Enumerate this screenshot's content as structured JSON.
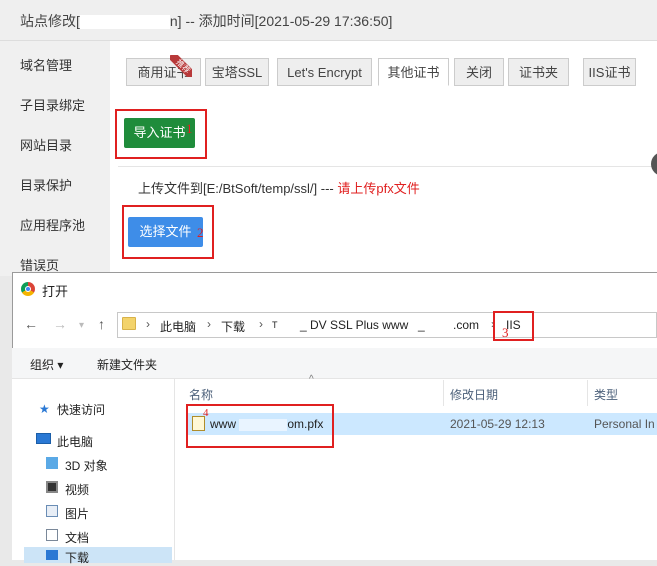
{
  "window": {
    "title_prefix": "站点修改[",
    "title_suffix": "n] -- 添加时间[2021-05-29 17:36:50]"
  },
  "sidebar": {
    "items": [
      {
        "label": "域名管理"
      },
      {
        "label": "子目录绑定"
      },
      {
        "label": "网站目录"
      },
      {
        "label": "目录保护"
      },
      {
        "label": "应用程序池"
      },
      {
        "label": "错误页"
      }
    ]
  },
  "tabs": [
    {
      "label": "商用证书"
    },
    {
      "label": "宝塔SSL"
    },
    {
      "label": "Let's Encrypt"
    },
    {
      "label": "其他证书",
      "active": true
    },
    {
      "label": "关闭"
    },
    {
      "label": "证书夹"
    },
    {
      "label": "IIS证书"
    }
  ],
  "ribbon": "推荐",
  "import_button": "导入证书",
  "upload": {
    "title": "上传文件到[E:/BtSoft/temp/ssl/] --- ",
    "warning": "请上传pfx文件",
    "choose_button": "选择文件"
  },
  "annotations": [
    "1",
    "2",
    "3",
    "4"
  ],
  "dialog": {
    "title": "打开",
    "nav": {
      "back": "←",
      "forward": "→",
      "up": "↑"
    },
    "breadcrumb": [
      "此电脑",
      "下载",
      "T",
      "_ DV SSL Plus www",
      "_",
      ".com",
      "IIS"
    ],
    "toolbar": {
      "organize": "组织 ▾",
      "new_folder": "新建文件夹"
    },
    "nav_pane": [
      {
        "label": "快速访问",
        "icon": "star-icon"
      },
      {
        "label": "此电脑",
        "icon": "computer-icon"
      },
      {
        "label": "3D 对象",
        "icon": "cube-icon"
      },
      {
        "label": "视频",
        "icon": "video-icon"
      },
      {
        "label": "图片",
        "icon": "picture-icon"
      },
      {
        "label": "文档",
        "icon": "document-icon"
      },
      {
        "label": "下载",
        "icon": "download-icon"
      }
    ],
    "columns": {
      "name": "名称",
      "modified": "修改日期",
      "type": "类型"
    },
    "files": [
      {
        "name_prefix": "www",
        "name_suffix": "om.pfx",
        "modified": "2021-05-29 12:13",
        "type": "Personal In"
      }
    ]
  },
  "colors": {
    "accent_red": "#e02020",
    "green_button": "#1f8c3b",
    "blue_button": "#3e8de8",
    "selection": "#cce8ff"
  }
}
